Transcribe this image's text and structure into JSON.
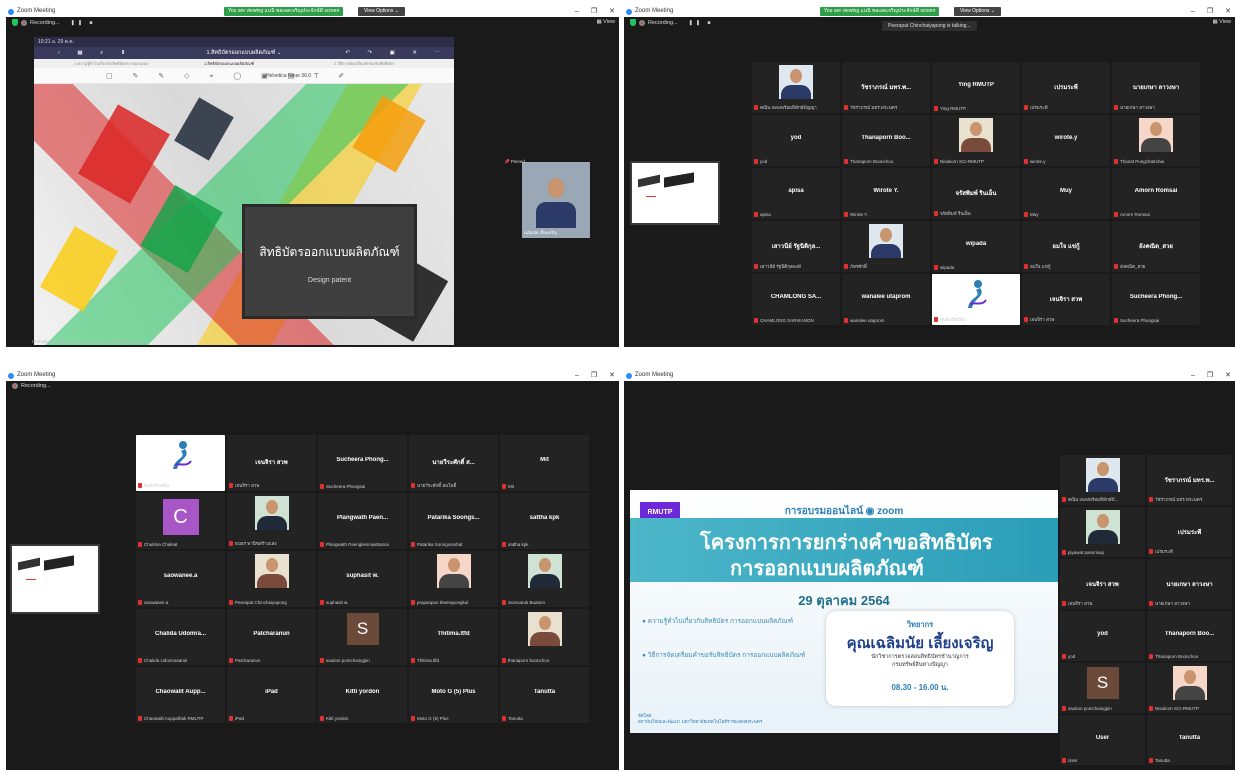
{
  "app_title": "Zoom Meeting",
  "recording_label": "Recording...",
  "view_label": "View",
  "share_banner": "You are viewing แนนิ พลเลดเจริญประจักษ์ดี screen",
  "view_options": "View Options ⌄",
  "q1": {
    "ipad_status": "10:21  อ. 29 ต.ค.",
    "ipad_doc_title": "1.สิทธิบัตรออกแบบผลิตภัณฑ์ ⌄",
    "ipad_nav_left": "‹ ▦ ⌕ ⬆",
    "ipad_nav_right": "↶ ↷ ▣ ✕ ⋯",
    "tab1": "1.ความรู้ทั่วไปเกี่ยวกับสิทธิบัตรการออกแบบ",
    "tab2": "1.สิทธิบัตรออกแบบผลิตภัณฑ์",
    "tab3": "2.วิธีการจัดเตรียมคำขอรับสิทธิบัตร",
    "tools": "▢ ✎ ✎ ◇ ⌖ ◯ ▣ ▤ T ✐",
    "font_label": "Helvetica Neue  36.0",
    "slide_th": "สิทธิบัตรออกแบบผลิตภัณฑ์",
    "slide_en": "Design patent",
    "pin_label": "📌 Pinned",
    "speaker_name": "เฉลิมนัย เลี้ยงเจริญ",
    "tip": "Unmute My Audio (Alt+A). Or you can simply press and"
  },
  "q2": {
    "talking": "Peerapat Chinchaiyapong is talking...",
    "tiles": [
      {
        "name": "",
        "label": "คณิน เพลงพร้อมพิทักษ์ปัญญา",
        "photo": true
      },
      {
        "name": "วัชราภรณ์ มทร.พ...",
        "label": "วัชราภรณ์ มทร.พระนคร"
      },
      {
        "name": "Ying RMUTP",
        "label": "Ying RMUTP"
      },
      {
        "name": "เปรมระพี",
        "label": "เปรมระพี"
      },
      {
        "name": "นายเกษา ลาวงษา",
        "label": "นายเกษา ลาวงษา"
      },
      {
        "name": "yod",
        "label": "yod"
      },
      {
        "name": "Thanaporn Boo...",
        "label": "Thanaporn Boonchoo"
      },
      {
        "name": "",
        "label": "Nisakorn SCI-RMUTP",
        "photo": true
      },
      {
        "name": "wirote.y",
        "label": "wirote.y"
      },
      {
        "name": "",
        "label": "Thanat Pungchatrchai",
        "photo": true
      },
      {
        "name": "apisa",
        "label": "apisa"
      },
      {
        "name": "Wirote Y.",
        "label": "Wirote Y."
      },
      {
        "name": "จรัสพิมพ์ รินเอ็น",
        "label": "จรัสพิมพ์ รินเอ็น"
      },
      {
        "name": "Muy",
        "label": "Muy"
      },
      {
        "name": "Amorn Romsai",
        "label": "Amorn Romsai"
      },
      {
        "name": "เสาวนีย์ รัฐนิติกุล...",
        "label": "เสาวนีย์ รัฐนิติกุลพงษ์"
      },
      {
        "name": "",
        "label": "ภัทรศักดิ์",
        "photo": true
      },
      {
        "name": "wipada",
        "label": "wipada"
      },
      {
        "name": "อมใจ แข่กู้",
        "label": "อมใจ แข่กู้"
      },
      {
        "name": "อังคณิต_สวย",
        "label": "อังคณิต_สวย"
      },
      {
        "name": "CHAMLONG SA...",
        "label": "CHAMLONG SARIKANON"
      },
      {
        "name": "wanalee utaprom",
        "label": "wanalee utaprom"
      },
      {
        "name": "",
        "label": "ศูนย์ทรัพย์สิน",
        "logo": true
      },
      {
        "name": "เจนจิรา สวพ",
        "label": "เจนจิรา สวพ"
      },
      {
        "name": "Sucheera Phong...",
        "label": "Sucheera Phongsai"
      }
    ]
  },
  "q3": {
    "tiles": [
      {
        "name": "",
        "label": "ศูนย์ทรัพย์สิน",
        "logo": true
      },
      {
        "name": "เจนจิรา สวพ",
        "label": "เจนจิรา สวพ"
      },
      {
        "name": "Sucheera Phong...",
        "label": "Sucheera Phongsai"
      },
      {
        "name": "นายวีระศักดิ์ ส...",
        "label": "นายวีระศักดิ์ สมโพธิ์"
      },
      {
        "name": "Mit",
        "label": "Mit"
      },
      {
        "name": "",
        "label": "Chutima Chaleat",
        "avatar": "C"
      },
      {
        "name": "",
        "label": "ธนธร พานิชสร้างแสง",
        "photo": true
      },
      {
        "name": "Plangwath Paen...",
        "label": "Plangwath Paengkesmaiittamai"
      },
      {
        "name": "Patarika Soongs...",
        "label": "Patarika Soongsombat"
      },
      {
        "name": "sattha kpk",
        "label": "sattha kpk"
      },
      {
        "name": "saowanee.a",
        "label": "saowanee.a"
      },
      {
        "name": "",
        "label": "Peerapat Chinchaiyapong",
        "photo": true
      },
      {
        "name": "suphasit w.",
        "label": "suphasit w."
      },
      {
        "name": "",
        "label": "prapanpon theerapongkul",
        "photo": true
      },
      {
        "name": "",
        "label": "Somsaruk Buatom",
        "photo": true
      },
      {
        "name": "Chalida Udomra...",
        "label": "Chalida Udomrasaruk"
      },
      {
        "name": "Patcharanun",
        "label": "Patcharanun"
      },
      {
        "name": "",
        "label": "sauiton pomchaingpin",
        "avatar": "S"
      },
      {
        "name": "Thitima.ltfd",
        "label": "Thitima.ltfd"
      },
      {
        "name": "",
        "label": "thanaporn boonchoo",
        "photo": true
      },
      {
        "name": "Chaowalit Aupp...",
        "label": "Chaowalit Auppathak RMUTP"
      },
      {
        "name": "iPad",
        "label": "iPad"
      },
      {
        "name": "Kitti yordon",
        "label": "Kitti yordon"
      },
      {
        "name": "Moto G (5) Plus",
        "label": "Moto G (5) Plus"
      },
      {
        "name": "Tanutta",
        "label": "Tanutta"
      }
    ]
  },
  "q4": {
    "slide_head": "การอบรมออนไลน์  ◉ zoom",
    "rmutp": "RMUTP",
    "title1": "โครงการการยกร่างคำขอสิทธิบัตร",
    "title2": "การออกแบบผลิตภัณฑ์",
    "date": "29 ตุลาคม 2564",
    "bullet1": "ความรู้ทั่วไปเกี่ยวกับสิทธิบัตร การออกแบบผลิตภัณฑ์",
    "bullet2": "วิธีการจัดเตรียมคำขอรับสิทธิบัตร การออกแบบผลิตภัณฑ์",
    "speaker_role": "วิทยากร",
    "speaker_name": "คุณเฉลิมนัย เลี้ยงเจริญ",
    "speaker_pos1": "นักวิชาการตรวจสอบสิทธิบัตรชำนาญการ",
    "speaker_pos2": "กรมทรัพย์สินทางปัญญา",
    "time": "08.30 - 16.00 น.",
    "organizer": "จัดโดย",
    "organizer2": "สถาบันวิจัยและพัฒนา มหาวิทยาลัยเทคโนโลยีราชมงคลพระนคร",
    "tiles": [
      {
        "name": "",
        "label": "คณิน เพลงพร้อมพิทักษ์ปั...",
        "photo": true
      },
      {
        "name": "วัชราภรณ์ มทร.พ...",
        "label": "วัชราภรณ์ มทร.พระนคร"
      },
      {
        "name": "",
        "label": "piyawat pansrisup",
        "photo": true
      },
      {
        "name": "เปรมระพี",
        "label": "เปรมระพี"
      },
      {
        "name": "เจนจิรา สวพ",
        "label": "เจนจิรา สวพ"
      },
      {
        "name": "นายเกษา ลาวงษา",
        "label": "นายเกษา ลาวงษา"
      },
      {
        "name": "yod",
        "label": "yod"
      },
      {
        "name": "Thanaporn Boo...",
        "label": "Thanaporn Boonchoo"
      },
      {
        "name": "",
        "label": "sauiton pomchaingpin",
        "avatar": "S"
      },
      {
        "name": "",
        "label": "Nisakorn SCI-RMUTP",
        "photo": true
      },
      {
        "name": "User",
        "label": "User"
      },
      {
        "name": "Tanutta",
        "label": "Tanutta"
      }
    ]
  }
}
